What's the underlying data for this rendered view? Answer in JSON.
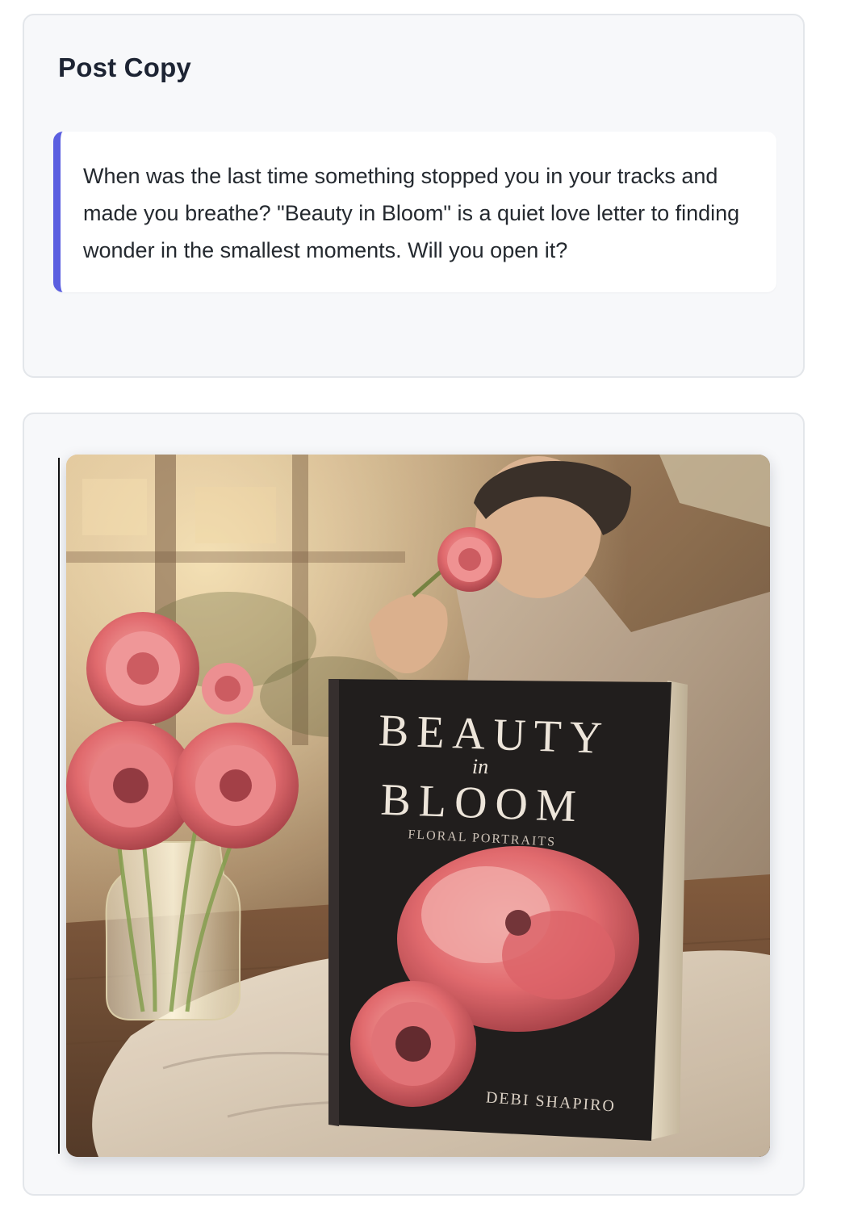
{
  "post_copy": {
    "title": "Post Copy",
    "text": "When was the last time something stopped you in your tracks and made you breathe? \"Beauty in Bloom\" is a quiet love letter to finding wonder in the smallest moments. Will you open it?"
  },
  "post_image": {
    "book_title_top": "BEAUTY",
    "book_title_mid": "in",
    "book_title_bottom": "BLOOM",
    "book_subtitle": "FLORAL PORTRAITS",
    "book_author": "DEBI SHAPIRO",
    "colors": {
      "accent_bar": "#5b5fe0",
      "book_cover": "#141214",
      "flower_pink": "#e0636a"
    }
  }
}
